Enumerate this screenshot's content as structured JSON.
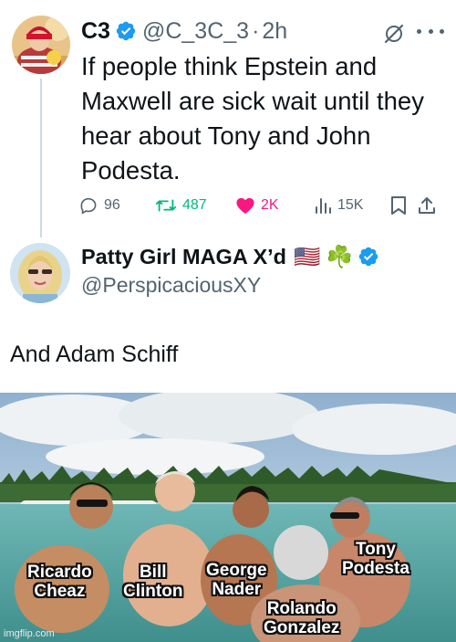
{
  "tweet1": {
    "display_name": "C3",
    "handle": "@C_3C_3",
    "separator": "·",
    "time": "2h",
    "text": "If people think Epstein and Maxwell are sick wait until they hear about Tony and John Podesta.",
    "icons": {
      "verified": "verified-badge-icon",
      "grok": "grok-icon",
      "more": "more-icon"
    },
    "actions": {
      "replies": "96",
      "retweets": "487",
      "likes": "2K",
      "views": "15K"
    }
  },
  "tweet2": {
    "display_name": "Patty Girl MAGA X’d",
    "emojis": "🇺🇸 ☘️",
    "handle": "@PerspicaciousXY",
    "text": "And Adam Schiff"
  },
  "meme": {
    "captions": [
      {
        "line1": "Ricardo",
        "line2": "Cheaz"
      },
      {
        "line1": "Bill",
        "line2": "Clinton"
      },
      {
        "line1": "George",
        "line2": "Nader"
      },
      {
        "line1": "Tony",
        "line2": "Podesta"
      },
      {
        "line1": "Rolando",
        "line2": "Gonzalez"
      }
    ],
    "watermark": "imgflip.com"
  },
  "colors": {
    "text_primary": "#0f1419",
    "text_secondary": "#536471",
    "verified_blue": "#1d9bf0",
    "retweet_green": "#00ba7c",
    "like_pink": "#f91880",
    "thread_line": "#cfd9de"
  }
}
